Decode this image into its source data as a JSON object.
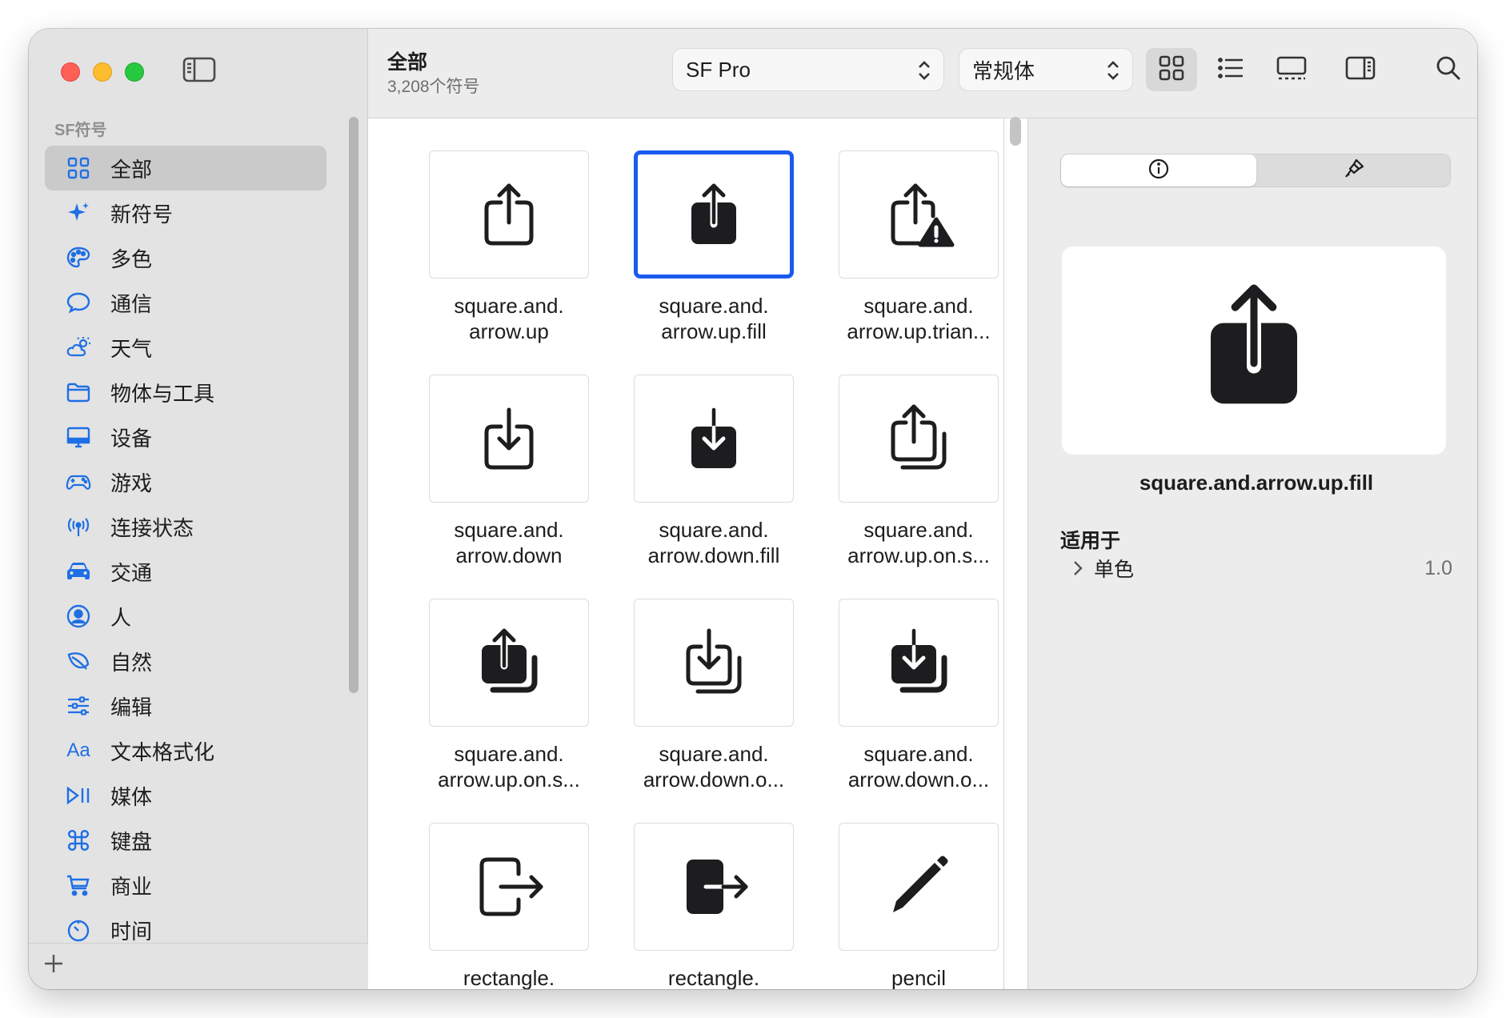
{
  "sidebar": {
    "section": "SF符号",
    "items": [
      {
        "label": "全部",
        "icon": "grid-icon",
        "selected": true
      },
      {
        "label": "新符号",
        "icon": "sparkles-icon"
      },
      {
        "label": "多色",
        "icon": "palette-icon"
      },
      {
        "label": "通信",
        "icon": "bubble-icon"
      },
      {
        "label": "天气",
        "icon": "cloud-sun-icon"
      },
      {
        "label": "物体与工具",
        "icon": "folder-icon"
      },
      {
        "label": "设备",
        "icon": "display-icon"
      },
      {
        "label": "游戏",
        "icon": "gamecontroller-icon"
      },
      {
        "label": "连接状态",
        "icon": "antenna-icon"
      },
      {
        "label": "交通",
        "icon": "car-icon"
      },
      {
        "label": "人",
        "icon": "person-circle-icon"
      },
      {
        "label": "自然",
        "icon": "leaf-icon"
      },
      {
        "label": "编辑",
        "icon": "sliders-icon"
      },
      {
        "label": "文本格式化",
        "icon": "text-aa-icon",
        "glyph": "Aa"
      },
      {
        "label": "媒体",
        "icon": "play-pause-icon"
      },
      {
        "label": "键盘",
        "icon": "command-icon"
      },
      {
        "label": "商业",
        "icon": "cart-icon"
      },
      {
        "label": "时间",
        "icon": "timer-icon"
      }
    ]
  },
  "toolbar": {
    "title": "全部",
    "subtitle": "3,208个符号",
    "font_select": "SF Pro",
    "weight_select": "常规体"
  },
  "grid": {
    "tiles": [
      {
        "label": "square.and.\narrow.up",
        "icon": "square-and-arrow-up-icon"
      },
      {
        "label": "square.and.\narrow.up.fill",
        "icon": "square-and-arrow-up-fill-icon",
        "selected": true
      },
      {
        "label": "square.and.\narrow.up.trian...",
        "icon": "square-and-arrow-up-triangle-icon"
      },
      {
        "label": "square.and.\narrow.down",
        "icon": "square-and-arrow-down-icon"
      },
      {
        "label": "square.and.\narrow.down.fill",
        "icon": "square-and-arrow-down-fill-icon"
      },
      {
        "label": "square.and.\narrow.up.on.s...",
        "icon": "square-and-arrow-up-on-square-icon"
      },
      {
        "label": "square.and.\narrow.up.on.s...",
        "icon": "square-and-arrow-up-on-square-fill-icon"
      },
      {
        "label": "square.and.\narrow.down.o...",
        "icon": "square-and-arrow-down-on-square-icon"
      },
      {
        "label": "square.and.\narrow.down.o...",
        "icon": "square-and-arrow-down-on-square-fill-icon"
      },
      {
        "label": "rectangle.\nportrait.and.a...",
        "icon": "rectangle-portrait-and-arrow-right-icon"
      },
      {
        "label": "rectangle.\nportrait.and.a...",
        "icon": "rectangle-portrait-and-arrow-right-fill-icon"
      },
      {
        "label": "pencil",
        "icon": "pencil-icon"
      }
    ]
  },
  "inspector": {
    "symbol_name": "square.and.arrow.up.fill",
    "section_title": "适用于",
    "row_label": "单色",
    "row_version": "1.0"
  },
  "colors": {
    "accent": "#1f6fe5",
    "selection": "#1a5cf0",
    "symbol": "#1d1d1f"
  }
}
